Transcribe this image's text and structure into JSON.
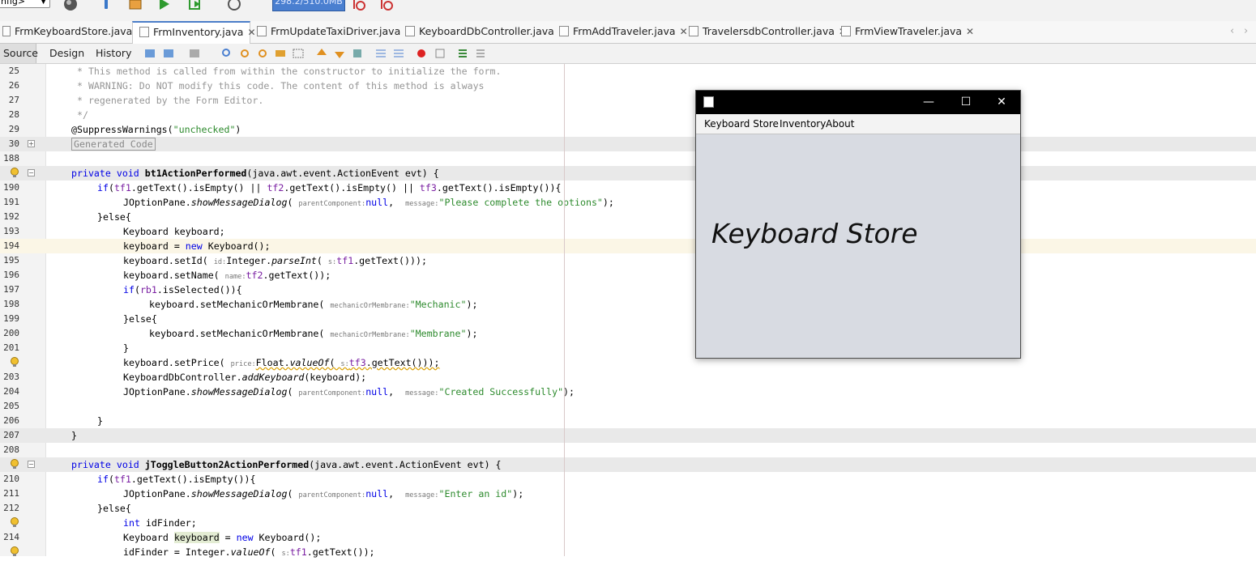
{
  "toolbar": {
    "config_value": "nfig>",
    "memory": "298.2/510.0MB"
  },
  "tabs": [
    {
      "label": "FrmKeyboardStore.java"
    },
    {
      "label": "FrmInventory.java"
    },
    {
      "label": "FrmUpdateTaxiDriver.java"
    },
    {
      "label": "KeyboardDbController.java"
    },
    {
      "label": "FrmAddTraveler.java"
    },
    {
      "label": "TravelersdbController.java"
    },
    {
      "label": "FrmViewTraveler.java"
    }
  ],
  "editor_tabs": {
    "source": "Source",
    "design": "Design",
    "history": "History"
  },
  "line_numbers": [
    "25",
    "26",
    "27",
    "28",
    "29",
    "30",
    "188",
    "",
    "190",
    "191",
    "192",
    "193",
    "194",
    "195",
    "196",
    "197",
    "198",
    "199",
    "200",
    "201",
    "",
    "203",
    "204",
    "205",
    "206",
    "207",
    "208",
    "",
    "210",
    "211",
    "212",
    "",
    "214",
    ""
  ],
  "code": {
    "l25": " * This method is called from within the constructor to initialize the form.",
    "l26": " * WARNING: Do NOT modify this code. The content of this method is always",
    "l27": " * regenerated by the Form Editor.",
    "l28": " */",
    "l29a": "@SuppressWarnings(",
    "l29b": "\"unchecked\"",
    "l29c": ")",
    "l30": "Generated Code",
    "private": "private",
    "void": "void",
    "bt1": "bt1ActionPerformed",
    "evt_sig": "(java.awt.event.ActionEvent evt) {",
    "if": "if",
    "tf1": "tf1",
    "tf2": "tf2",
    "tf3": "tf3",
    "rb1": "rb1",
    "isEmpty": ".getText().isEmpty()",
    "or": " || ",
    "isEmptyEnd": ".getText().isEmpty()){",
    "jop": "JOptionPane.",
    "showMsg": "showMessageDialog",
    "hint_parent": "parentComponent:",
    "null": "null",
    "hint_message": "message:",
    "msg_complete": "\"Please complete the options\"",
    "close_paren": ");",
    "else": "}else{",
    "kb_decl": "Keyboard keyboard;",
    "kb_new_a": "keyboard = ",
    "new": "new",
    "kb_new_b": " Keyboard();",
    "setId": "keyboard.setId(",
    "hint_id": "id:",
    "integer": "Integer.",
    "parseInt": "parseInt",
    "hint_s": "s:",
    "getText3": ".getText()));",
    "setName": "keyboard.setName(",
    "hint_name": "name:",
    "getText2": ".getText());",
    "isSelected": ".isSelected()){",
    "setMech": "keyboard.setMechanicOrMembrane(",
    "hint_mech": "mechanicOrMembrane:",
    "mechanic": "\"Mechanic\"",
    "membrane": "\"Membrane\"",
    "brace": "}",
    "setPrice": "keyboard.setPrice(",
    "hint_price": "price:",
    "float": "Float.",
    "valueOf": "valueOf",
    "kdc": "KeyboardDbController.",
    "addKeyboard": "addKeyboard",
    "kb_arg": "(keyboard);",
    "msg_created": "\"Created Successfully\"",
    "jtog": "jToggleButton2ActionPerformed",
    "getTextEmpty": ".getText().isEmpty()){",
    "msg_enter": "\"Enter an id\"",
    "int": "int",
    "idFinder_decl": " idFinder;",
    "kb_type": "Keyboard ",
    "keyboard_var": "keyboard",
    "kb_eq": " = ",
    "idFinder_assign": "idFinder = Integer.",
    "getText_end": ".getText());"
  },
  "jframe": {
    "menu": [
      "Keyboard Store",
      "Inventory",
      "About"
    ],
    "label": "Keyboard Store",
    "minimize": "—",
    "maximize": "☐",
    "close": "✕"
  }
}
